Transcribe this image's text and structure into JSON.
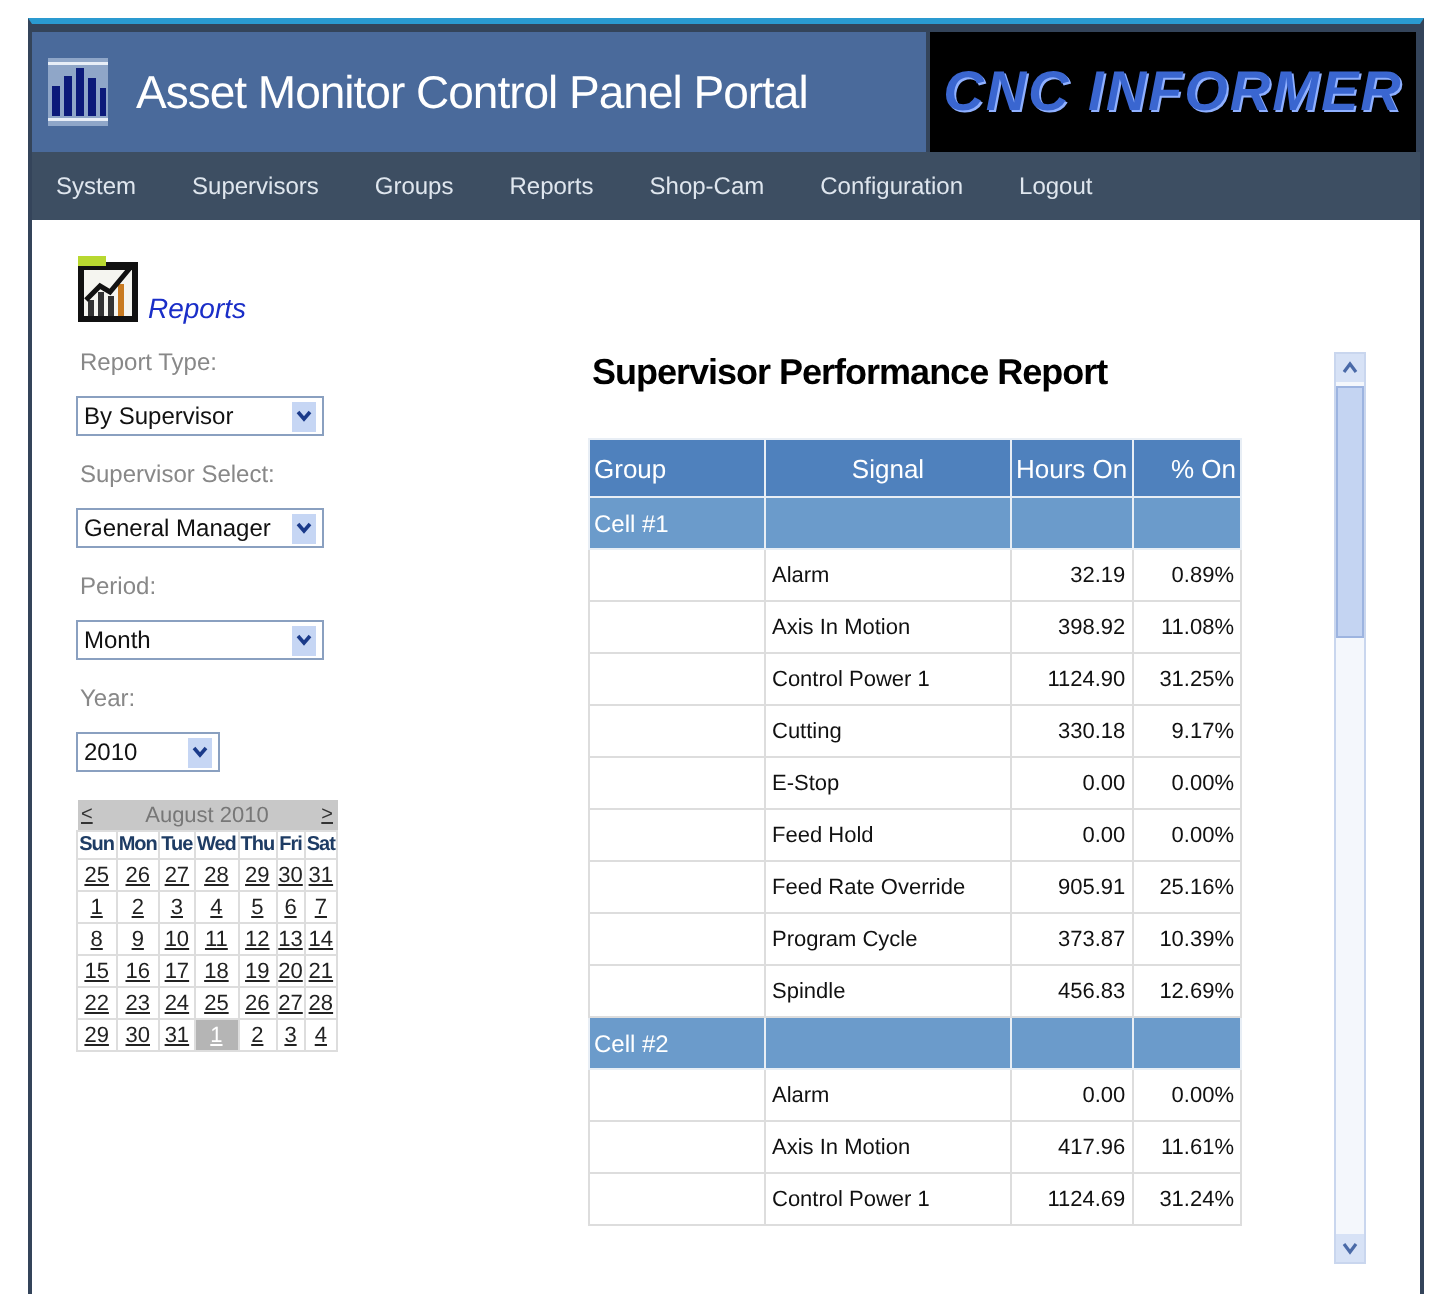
{
  "header": {
    "title": "Asset Monitor Control Panel Portal",
    "logo_text": "CNC INFORMER"
  },
  "nav": [
    {
      "label": "System"
    },
    {
      "label": "Supervisors"
    },
    {
      "label": "Groups"
    },
    {
      "label": "Reports"
    },
    {
      "label": "Shop-Cam"
    },
    {
      "label": "Configuration"
    },
    {
      "label": "Logout"
    }
  ],
  "sidebar": {
    "section_title": "Reports",
    "fields": [
      {
        "label": "Report Type:",
        "value": "By Supervisor"
      },
      {
        "label": "Supervisor Select:",
        "value": "General Manager"
      },
      {
        "label": "Period:",
        "value": "Month"
      },
      {
        "label": "Year:",
        "value": "2010"
      }
    ],
    "calendar": {
      "prev": "<",
      "title": "August 2010",
      "next": ">",
      "weekdays": [
        "Sun",
        "Mon",
        "Tue",
        "Wed",
        "Thu",
        "Fri",
        "Sat"
      ],
      "weeks": [
        [
          {
            "day": "25",
            "selected": false
          },
          {
            "day": "26",
            "selected": false
          },
          {
            "day": "27",
            "selected": false
          },
          {
            "day": "28",
            "selected": false
          },
          {
            "day": "29",
            "selected": false
          },
          {
            "day": "30",
            "selected": false
          },
          {
            "day": "31",
            "selected": false
          }
        ],
        [
          {
            "day": "1",
            "selected": false
          },
          {
            "day": "2",
            "selected": false
          },
          {
            "day": "3",
            "selected": false
          },
          {
            "day": "4",
            "selected": false
          },
          {
            "day": "5",
            "selected": false
          },
          {
            "day": "6",
            "selected": false
          },
          {
            "day": "7",
            "selected": false
          }
        ],
        [
          {
            "day": "8",
            "selected": false
          },
          {
            "day": "9",
            "selected": false
          },
          {
            "day": "10",
            "selected": false
          },
          {
            "day": "11",
            "selected": false
          },
          {
            "day": "12",
            "selected": false
          },
          {
            "day": "13",
            "selected": false
          },
          {
            "day": "14",
            "selected": false
          }
        ],
        [
          {
            "day": "15",
            "selected": false
          },
          {
            "day": "16",
            "selected": false
          },
          {
            "day": "17",
            "selected": false
          },
          {
            "day": "18",
            "selected": false
          },
          {
            "day": "19",
            "selected": false
          },
          {
            "day": "20",
            "selected": false
          },
          {
            "day": "21",
            "selected": false
          }
        ],
        [
          {
            "day": "22",
            "selected": false
          },
          {
            "day": "23",
            "selected": false
          },
          {
            "day": "24",
            "selected": false
          },
          {
            "day": "25",
            "selected": false
          },
          {
            "day": "26",
            "selected": false
          },
          {
            "day": "27",
            "selected": false
          },
          {
            "day": "28",
            "selected": false
          }
        ],
        [
          {
            "day": "29",
            "selected": false
          },
          {
            "day": "30",
            "selected": false
          },
          {
            "day": "31",
            "selected": false
          },
          {
            "day": "1",
            "selected": true
          },
          {
            "day": "2",
            "selected": false
          },
          {
            "day": "3",
            "selected": false
          },
          {
            "day": "4",
            "selected": false
          }
        ]
      ]
    }
  },
  "report": {
    "title": "Supervisor Performance Report",
    "columns": [
      "Group",
      "Signal",
      "Hours On",
      "% On"
    ],
    "groups": [
      {
        "name": "Cell #1",
        "rows": [
          {
            "signal": "Alarm",
            "hours": "32.19",
            "percent": "0.89%"
          },
          {
            "signal": "Axis In Motion",
            "hours": "398.92",
            "percent": "11.08%"
          },
          {
            "signal": "Control Power 1",
            "hours": "1124.90",
            "percent": "31.25%"
          },
          {
            "signal": "Cutting",
            "hours": "330.18",
            "percent": "9.17%"
          },
          {
            "signal": "E-Stop",
            "hours": "0.00",
            "percent": "0.00%"
          },
          {
            "signal": "Feed Hold",
            "hours": "0.00",
            "percent": "0.00%"
          },
          {
            "signal": "Feed Rate Override",
            "hours": "905.91",
            "percent": "25.16%"
          },
          {
            "signal": "Program Cycle",
            "hours": "373.87",
            "percent": "10.39%"
          },
          {
            "signal": "Spindle",
            "hours": "456.83",
            "percent": "12.69%"
          }
        ]
      },
      {
        "name": "Cell #2",
        "rows": [
          {
            "signal": "Alarm",
            "hours": "0.00",
            "percent": "0.00%"
          },
          {
            "signal": "Axis In Motion",
            "hours": "417.96",
            "percent": "11.61%"
          },
          {
            "signal": "Control Power 1",
            "hours": "1124.69",
            "percent": "31.24%"
          }
        ]
      }
    ]
  }
}
